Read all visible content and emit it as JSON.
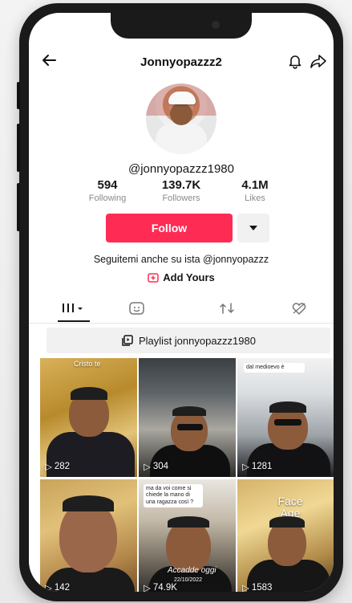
{
  "header": {
    "title": "Jonnyopazzz2"
  },
  "profile": {
    "username": "@jonnyopazzz1980",
    "stats": [
      {
        "value": "594",
        "label": "Following"
      },
      {
        "value": "139.7K",
        "label": "Followers"
      },
      {
        "value": "4.1M",
        "label": "Likes"
      }
    ],
    "follow_label": "Follow",
    "bio": "Seguitemi anche su ista @jonnyopazzz",
    "add_yours": "Add Yours"
  },
  "playlist": {
    "label": "Playlist jonnyopazzz1980"
  },
  "videos": [
    {
      "views": "282",
      "caption": "Cristo te"
    },
    {
      "views": "304"
    },
    {
      "views": "1281",
      "caption": "dal medioevo è"
    },
    {
      "views": "142"
    },
    {
      "views": "74.9K",
      "caption": "ma da voi come si chiede la mano di una ragazza così ?",
      "overlay": "Accadde oggi",
      "date": "22/10/2022"
    },
    {
      "views": "1583",
      "overlay": "Face Age"
    }
  ],
  "colors": {
    "accent": "#fe2c55"
  }
}
